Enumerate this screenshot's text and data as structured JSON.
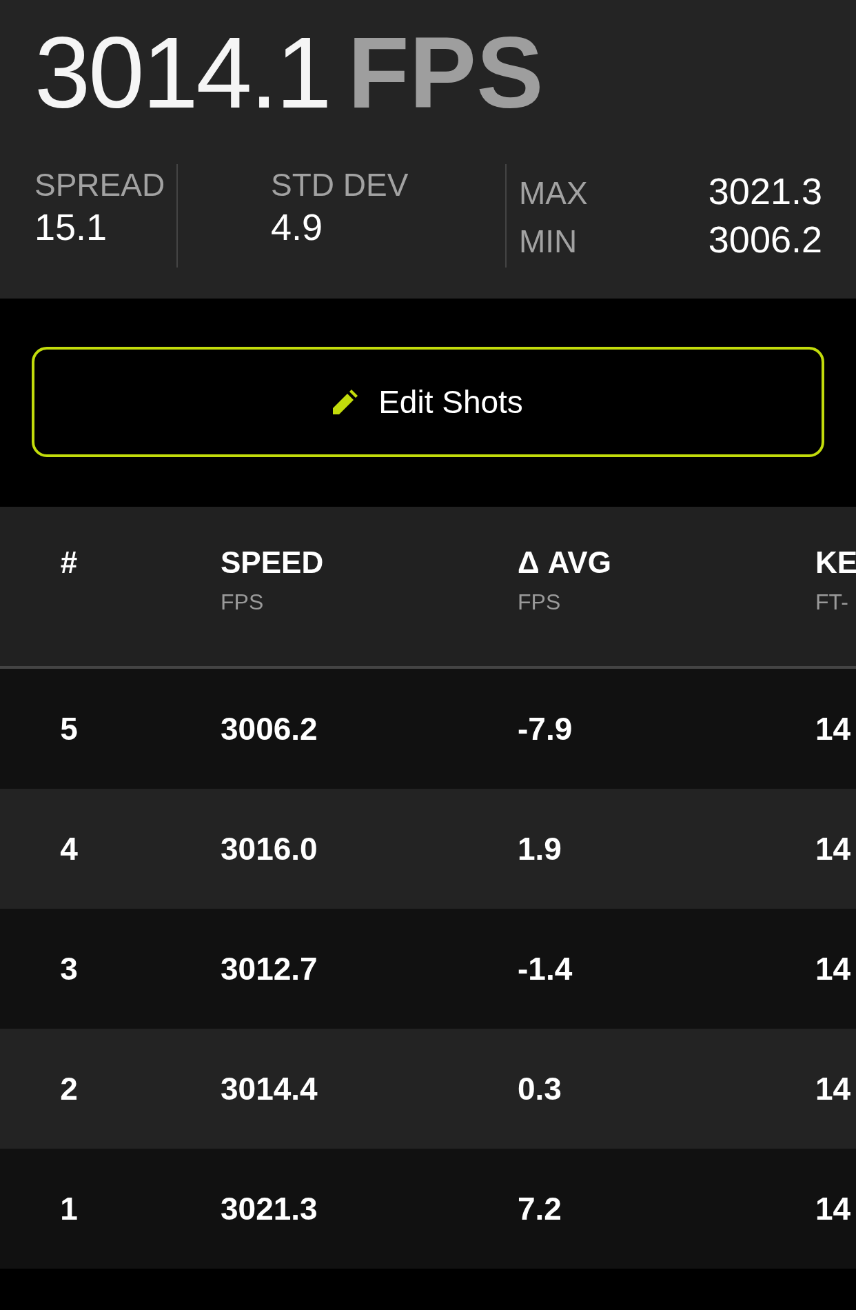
{
  "summary": {
    "average": "3014.1",
    "unit": "FPS"
  },
  "stats": [
    {
      "label": "SPREAD",
      "value": "15.1"
    },
    {
      "label": "STD DEV",
      "value": "4.9"
    }
  ],
  "extremes": [
    {
      "label": "MAX",
      "value": "3021.3"
    },
    {
      "label": "MIN",
      "value": "3006.2"
    }
  ],
  "edit_button": {
    "label": "Edit Shots"
  },
  "table": {
    "columns": [
      {
        "title": "#"
      },
      {
        "title": "SPEED",
        "unit": "FPS"
      },
      {
        "title": "Δ AVG",
        "unit": "FPS"
      },
      {
        "title": "KE",
        "unit": "FT-"
      }
    ],
    "rows": [
      {
        "cells": [
          "5",
          "3006.2",
          "-7.9",
          "14"
        ]
      },
      {
        "cells": [
          "4",
          "3016.0",
          "1.9",
          "14"
        ]
      },
      {
        "cells": [
          "3",
          "3012.7",
          "-1.4",
          "14"
        ]
      },
      {
        "cells": [
          "2",
          "3014.4",
          "0.3",
          "14"
        ]
      },
      {
        "cells": [
          "1",
          "3021.3",
          "7.2",
          "14"
        ]
      }
    ]
  }
}
